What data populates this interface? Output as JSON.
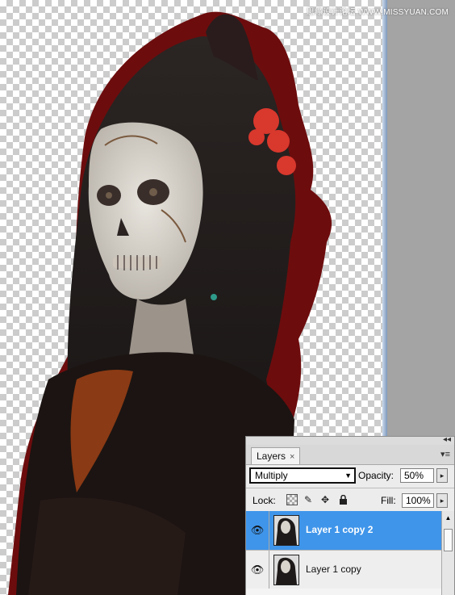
{
  "watermark": "思缘设计论坛 WWW.MISSYUAN.COM",
  "canvas": {
    "content": "photo-portrait"
  },
  "layers_panel": {
    "tab_label": "Layers",
    "tab_close": "×",
    "panel_menu": "▾≡",
    "collapse": "◂◂",
    "blend_mode": "Multiply",
    "opacity_label": "Opacity:",
    "opacity_value": "50%",
    "lock_label": "Lock:",
    "fill_label": "Fill:",
    "fill_value": "100%",
    "stepper_glyph": "▸",
    "layers": [
      {
        "name": "Layer 1 copy 2",
        "selected": true,
        "visible": true
      },
      {
        "name": "Layer 1 copy",
        "selected": false,
        "visible": true
      }
    ]
  },
  "colors": {
    "selection": "#3f95ea",
    "checker": "#cccccc",
    "backdrop_red": "#7a0f10"
  }
}
